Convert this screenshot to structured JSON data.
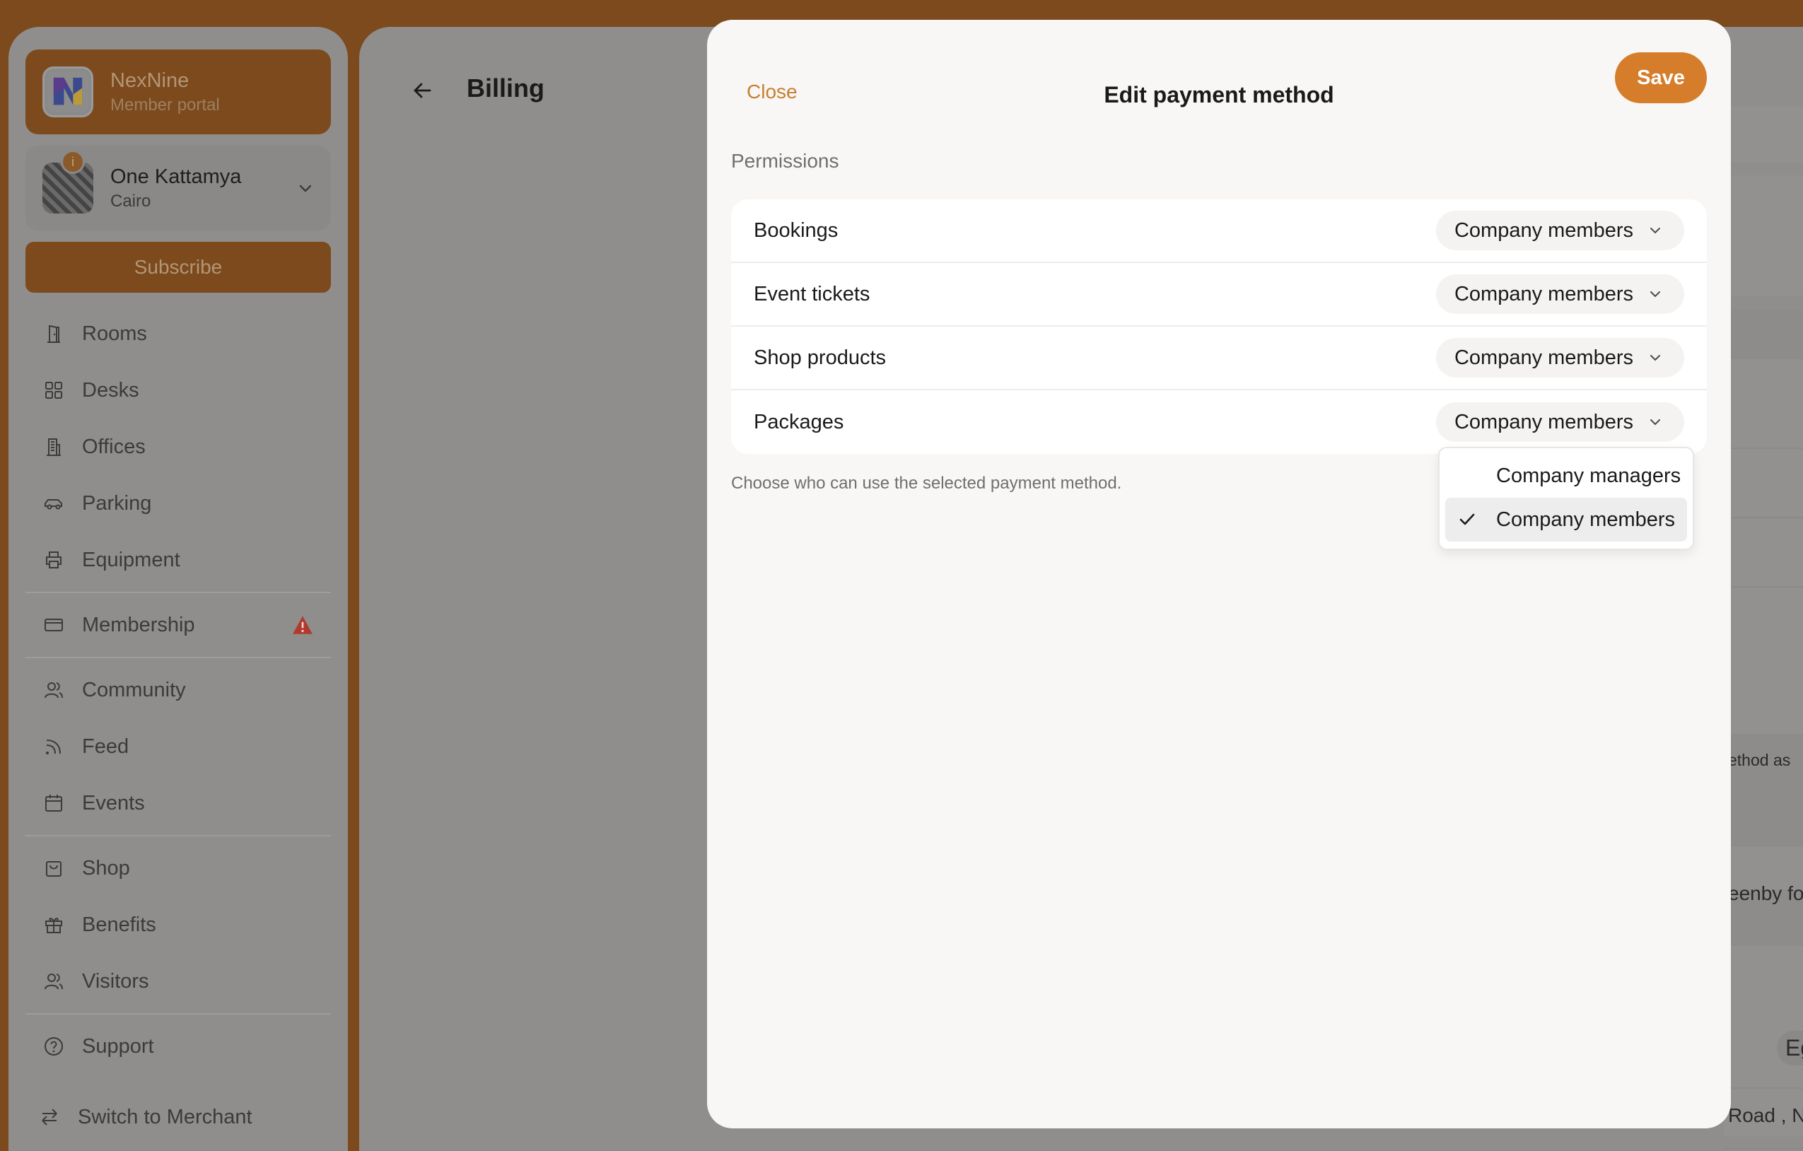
{
  "brand": {
    "name": "NexNine",
    "subtitle": "Member portal"
  },
  "location": {
    "name": "One Kattamya",
    "city": "Cairo"
  },
  "subscribe_label": "Subscribe",
  "nav": {
    "rooms": "Rooms",
    "desks": "Desks",
    "offices": "Offices",
    "parking": "Parking",
    "equipment": "Equipment",
    "membership": "Membership",
    "community": "Community",
    "feed": "Feed",
    "events": "Events",
    "shop": "Shop",
    "benefits": "Benefits",
    "visitors": "Visitors",
    "support": "Support",
    "switch": "Switch to Merchant"
  },
  "page": {
    "title": "Billing"
  },
  "background_fragments": {
    "frag1": "ethod as",
    "frag2": "eenby fo",
    "frag3": "Eg",
    "frag4": "Road , N"
  },
  "modal": {
    "close_label": "Close",
    "title": "Edit payment method",
    "save_label": "Save",
    "section_label": "Permissions",
    "help_text": "Choose who can use the selected payment method.",
    "permissions": [
      {
        "label": "Bookings",
        "value": "Company members"
      },
      {
        "label": "Event tickets",
        "value": "Company members"
      },
      {
        "label": "Shop products",
        "value": "Company members"
      },
      {
        "label": "Packages",
        "value": "Company members"
      }
    ],
    "dropdown_options": [
      {
        "label": "Company managers",
        "selected": false
      },
      {
        "label": "Company members",
        "selected": true
      }
    ]
  },
  "colors": {
    "accent": "#d67d2b",
    "brand_dark": "#7c4a1d",
    "overlay": "#8f8e8c",
    "warning": "#b03a2e"
  }
}
